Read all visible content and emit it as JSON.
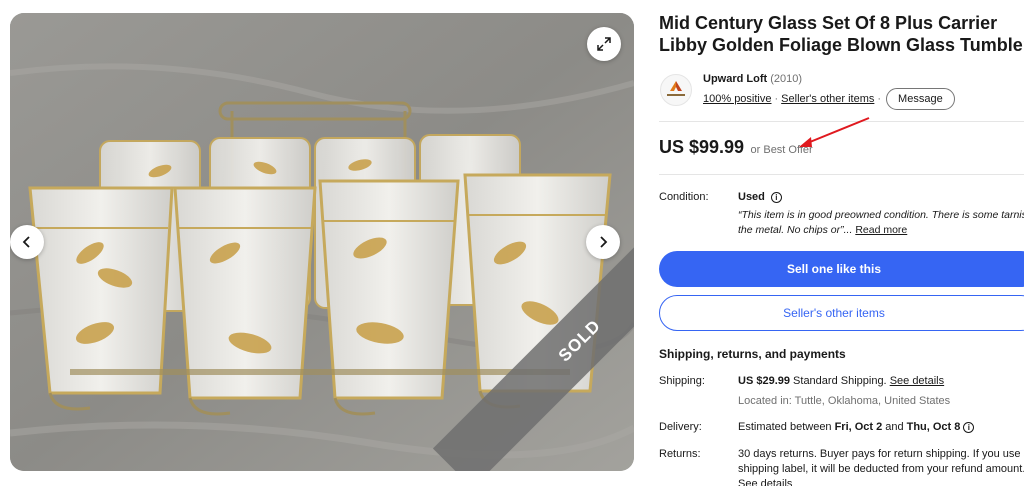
{
  "gallery": {
    "sold_label": "SOLD",
    "icons": {
      "expand": "expand-arrows-icon",
      "prev": "chevron-left-icon",
      "next": "chevron-right-icon"
    }
  },
  "listing": {
    "title": "Mid Century Glass Set Of 8 Plus Carrier Libby Golden Foliage Blown Glass Tumbler"
  },
  "seller": {
    "name": "Upward Loft",
    "feedback_count": "(2010)",
    "positive": "100% positive",
    "other_items_link": "Seller's other items",
    "message_button": "Message",
    "logo_text": "Upward Loft"
  },
  "price": {
    "amount": "US $99.99",
    "best_offer": "or Best Offer",
    "annotation_color": "#e0191f"
  },
  "condition": {
    "label": "Condition:",
    "value": "Used",
    "description": "“This item is in good preowned condition. There is some tarnish on",
    "description_line2": "the metal. No chips or”",
    "read_more": "Read more"
  },
  "buttons": {
    "sell_one": "Sell one like this",
    "sellers_other_items": "Seller's other items"
  },
  "shipping": {
    "heading": "Shipping, returns, and payments",
    "shipping_label": "Shipping:",
    "shipping_price": "US $29.99",
    "shipping_type": "Standard Shipping.",
    "see_details": "See details",
    "location": "Located in: Tuttle, Oklahoma, United States",
    "delivery_label": "Delivery:",
    "delivery_prefix": "Estimated between",
    "delivery_start": "Fri, Oct 2",
    "delivery_and": "and",
    "delivery_end": "Thu, Oct 8",
    "returns_label": "Returns:",
    "returns_line1": "30 days returns. Buyer pays for return shipping. If you use an eBay",
    "returns_line2": "shipping label, it will be deducted from your refund amount.",
    "returns_line3": "See details"
  },
  "colors": {
    "primary": "#3665f3",
    "text": "#191919",
    "muted": "#707070"
  }
}
